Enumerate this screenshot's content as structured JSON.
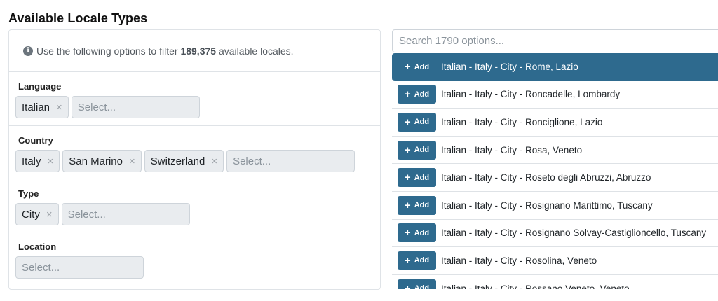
{
  "page": {
    "title": "Available Locale Types"
  },
  "filter": {
    "info_prefix": "Use the following options to filter",
    "info_count": "189,375",
    "info_suffix": "available locales."
  },
  "sections": [
    {
      "label": "Language",
      "chips": [
        "Italian"
      ],
      "placeholder": "Select..."
    },
    {
      "label": "Country",
      "chips": [
        "Italy",
        "San Marino",
        "Switzerland"
      ],
      "placeholder": "Select..."
    },
    {
      "label": "Type",
      "chips": [
        "City"
      ],
      "placeholder": "Select..."
    },
    {
      "label": "Location",
      "chips": [],
      "placeholder": "Select..."
    }
  ],
  "chip_remove_symbol": "×",
  "search": {
    "placeholder": "Search 1790 options..."
  },
  "results": {
    "add_label": "Add",
    "add_symbol": "+",
    "items": [
      "Italian - Italy - City - Rome, Lazio",
      "Italian - Italy - City - Roncadelle, Lombardy",
      "Italian - Italy - City - Ronciglione, Lazio",
      "Italian - Italy - City - Rosa, Veneto",
      "Italian - Italy - City - Roseto degli Abruzzi, Abruzzo",
      "Italian - Italy - City - Rosignano Marittimo, Tuscany",
      "Italian - Italy - City - Rosignano Solvay-Castiglioncello, Tuscany",
      "Italian - Italy - City - Rosolina, Veneto",
      "Italian - Italy - City - Rossano Veneto, Veneto"
    ]
  },
  "colors": {
    "accent": "#2e6a8e",
    "chip_bg": "#e9ecef",
    "border": "#dfe3e7"
  }
}
